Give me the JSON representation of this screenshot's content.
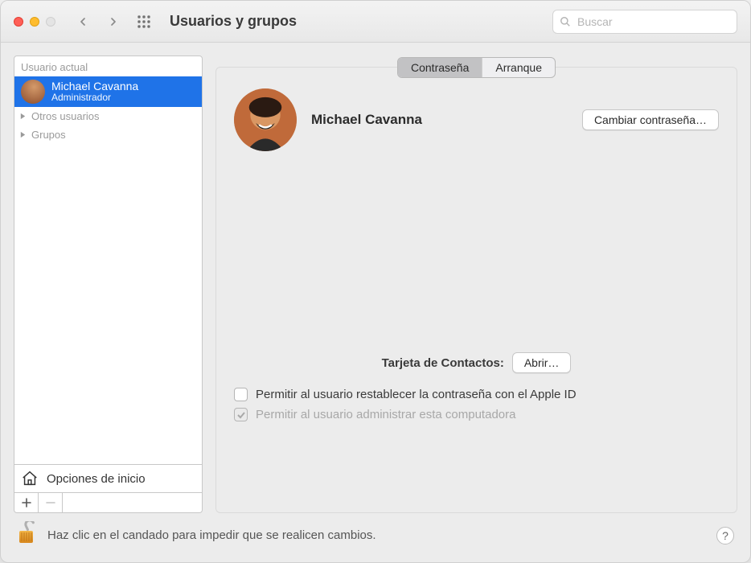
{
  "window": {
    "title": "Usuarios y grupos",
    "search_placeholder": "Buscar"
  },
  "sidebar": {
    "section_label": "Usuario actual",
    "current_user": {
      "name": "Michael Cavanna",
      "role": "Administrador"
    },
    "groups": {
      "other_users": "Otros usuarios",
      "groups": "Grupos"
    },
    "login_options": "Opciones de inicio"
  },
  "tabs": {
    "password": "Contraseña",
    "login": "Arranque",
    "selected": "password"
  },
  "detail": {
    "name": "Michael Cavanna",
    "change_password": "Cambiar contraseña…",
    "contacts_label": "Tarjeta de Contactos:",
    "open": "Abrir…",
    "allow_reset": "Permitir al usuario restablecer la contraseña con el Apple ID",
    "allow_admin": "Permitir al usuario administrar esta computadora",
    "allow_reset_checked": false,
    "allow_admin_checked": true
  },
  "footer": {
    "lock_message": "Haz clic en el candado para impedir que se realicen cambios."
  }
}
